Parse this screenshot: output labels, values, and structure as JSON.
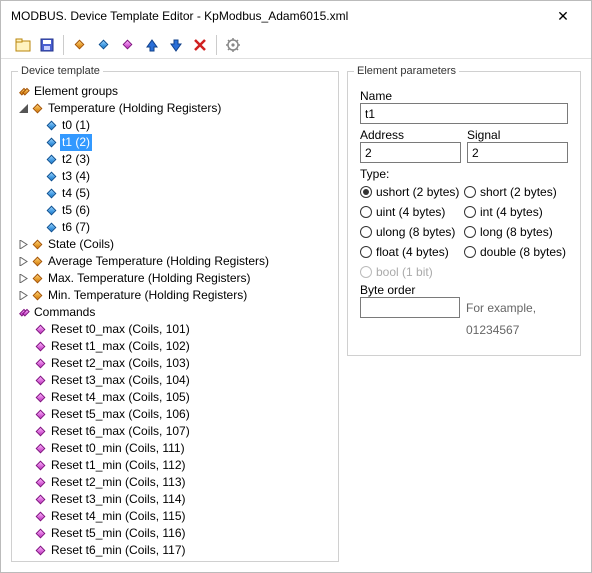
{
  "window": {
    "title": "MODBUS. Device Template Editor - KpModbus_Adam6015.xml"
  },
  "panels": {
    "left": "Device template",
    "right": "Element parameters"
  },
  "tree": {
    "root": "Element groups",
    "g_temp": "Temperature (Holding Registers)",
    "t0": "t0 (1)",
    "t1": "t1 (2)",
    "t2": "t2 (3)",
    "t3": "t3 (4)",
    "t4": "t4 (5)",
    "t5": "t5 (6)",
    "t6": "t6 (7)",
    "g_state": "State (Coils)",
    "g_avg": "Average Temperature (Holding Registers)",
    "g_max": "Max. Temperature (Holding Registers)",
    "g_min": "Min. Temperature (Holding Registers)",
    "commands": "Commands",
    "c": [
      "Reset t0_max (Coils, 101)",
      "Reset t1_max (Coils, 102)",
      "Reset t2_max (Coils, 103)",
      "Reset t3_max (Coils, 104)",
      "Reset t4_max (Coils, 105)",
      "Reset t5_max (Coils, 106)",
      "Reset t6_max (Coils, 107)",
      "Reset t0_min (Coils, 111)",
      "Reset t1_min (Coils, 112)",
      "Reset t2_min (Coils, 113)",
      "Reset t3_min (Coils, 114)",
      "Reset t4_min (Coils, 115)",
      "Reset t5_min (Coils, 116)",
      "Reset t6_min (Coils, 117)"
    ]
  },
  "params": {
    "name_lbl": "Name",
    "name_val": "t1",
    "addr_lbl": "Address",
    "addr_val": "2",
    "sig_lbl": "Signal",
    "sig_val": "2",
    "type_lbl": "Type:",
    "types": {
      "ushort": "ushort (2 bytes)",
      "short": "short (2 bytes)",
      "uint": "uint (4 bytes)",
      "int": "int (4 bytes)",
      "ulong": "ulong (8 bytes)",
      "long": "long (8 bytes)",
      "float": "float (4 bytes)",
      "double": "double (8 bytes)",
      "bool": "bool (1 bit)"
    },
    "selected_type": "ushort",
    "byteorder_lbl": "Byte order",
    "byteorder_val": "",
    "byteorder_hint": "For example, 01234567"
  }
}
